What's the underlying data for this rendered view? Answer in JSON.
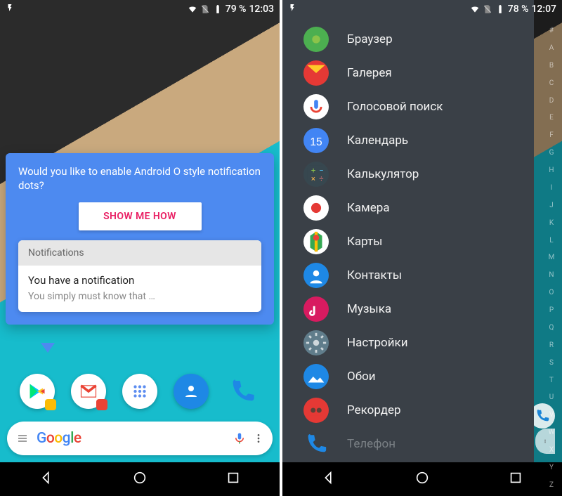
{
  "left": {
    "status": {
      "battery": "79 %",
      "time": "12:03"
    },
    "prompt": {
      "text": "Would you like to enable Android O style notification dots?",
      "button": "SHOW ME HOW",
      "notif_header": "Notifications",
      "notif_title": "You have a notification",
      "notif_sub": "You simply must know that …"
    },
    "dock": [
      {
        "name": "play-store",
        "badge": "#fbbc05"
      },
      {
        "name": "gmail",
        "badge": "#ea4335"
      },
      {
        "name": "app-drawer"
      },
      {
        "name": "contacts"
      },
      {
        "name": "phone"
      }
    ],
    "search_brand": "Google"
  },
  "right": {
    "status": {
      "battery": "78 %",
      "time": "12:07"
    },
    "apps": [
      {
        "name": "browser",
        "label": "Браузер",
        "bg": "#4caf50"
      },
      {
        "name": "gallery",
        "label": "Галерея",
        "bg": "#e53935"
      },
      {
        "name": "voice",
        "label": "Голосовой поиск",
        "bg": "#ffffff"
      },
      {
        "name": "calendar",
        "label": "Календарь",
        "bg": "#4285F4",
        "day": "15"
      },
      {
        "name": "calc",
        "label": "Калькулятор",
        "bg": "#37474f"
      },
      {
        "name": "camera",
        "label": "Камера",
        "bg": "#ffffff"
      },
      {
        "name": "maps",
        "label": "Карты",
        "bg": "#ffffff"
      },
      {
        "name": "contacts",
        "label": "Контакты",
        "bg": "#1e88e5"
      },
      {
        "name": "music",
        "label": "Музыка",
        "bg": "#d81b60"
      },
      {
        "name": "settings",
        "label": "Настройки",
        "bg": "#607d8b"
      },
      {
        "name": "wallpaper",
        "label": "Обои",
        "bg": "#1e88e5"
      },
      {
        "name": "recorder",
        "label": "Рекордер",
        "bg": "#e53935"
      },
      {
        "name": "phone",
        "label": "Телефон",
        "bg": "transparent"
      }
    ],
    "index": [
      "#",
      "A",
      "B",
      "C",
      "D",
      "E",
      "F",
      "G",
      "H",
      "I",
      "J",
      "K",
      "L",
      "M",
      "N",
      "O",
      "P",
      "Q",
      "R",
      "S",
      "T",
      "U",
      "V",
      "W",
      "X",
      "Y",
      "Z"
    ]
  }
}
